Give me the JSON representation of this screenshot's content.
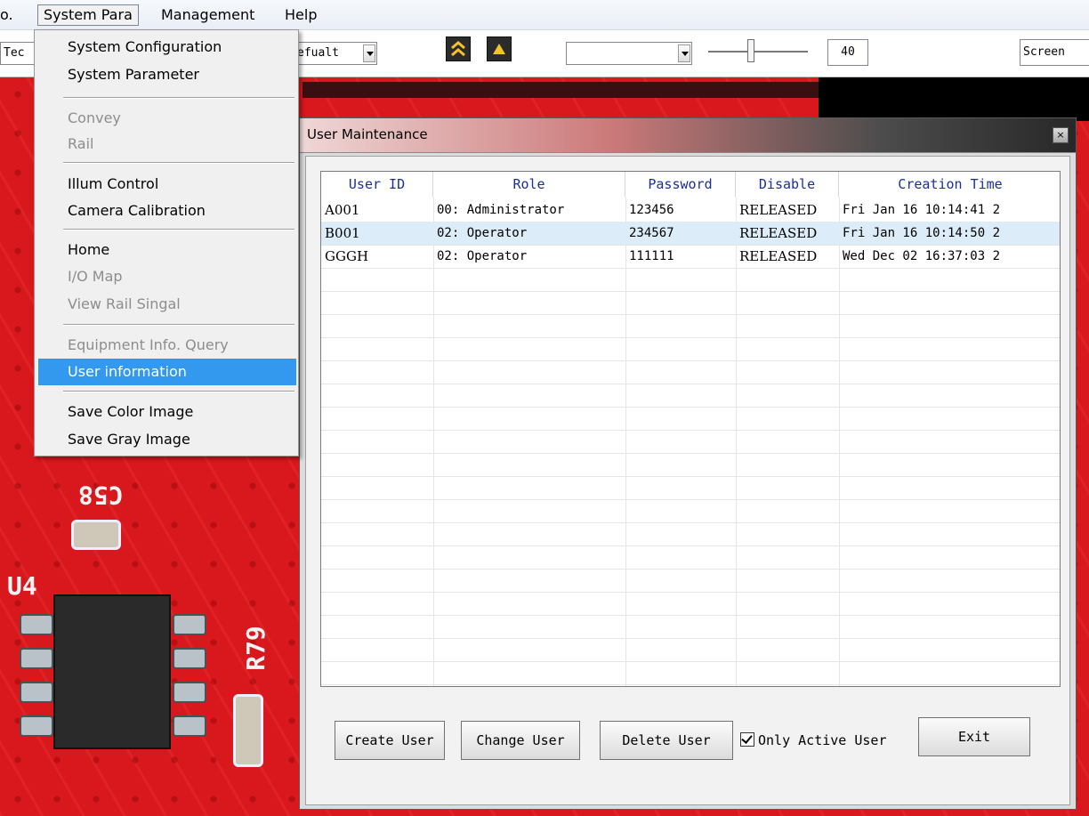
{
  "menubar": {
    "items": [
      "o.",
      "System Para",
      "Management",
      "Help"
    ]
  },
  "toolbar": {
    "left_combo": "Tec",
    "mode_combo": "efualt",
    "value_combo": "",
    "slider_value": 0.45,
    "number_box": "40",
    "screen_label": "Screen"
  },
  "menu": {
    "items": [
      {
        "label": "System Configuration",
        "enabled": true
      },
      {
        "label": "System Parameter",
        "enabled": true
      },
      {
        "label": "Convey",
        "enabled": false
      },
      {
        "label": "Rail",
        "enabled": false
      },
      {
        "label": "Illum Control",
        "enabled": true
      },
      {
        "label": "Camera Calibration",
        "enabled": true
      },
      {
        "label": "Home",
        "enabled": true
      },
      {
        "label": "I/O Map",
        "enabled": false
      },
      {
        "label": "View Rail Singal",
        "enabled": false
      },
      {
        "label": "Equipment Info. Query",
        "enabled": false
      },
      {
        "label": "User information",
        "enabled": true,
        "highlighted": true
      },
      {
        "label": "Save Color Image",
        "enabled": true
      },
      {
        "label": "Save Gray Image",
        "enabled": true
      }
    ]
  },
  "dialog": {
    "title": "User Maintenance",
    "close_label": "×",
    "columns": [
      "User ID",
      "Role",
      "Password",
      "Disable",
      "Creation Time"
    ],
    "rows": [
      {
        "user_id": "A001",
        "role": "00: Administrator",
        "password": "123456",
        "disable": "RELEASED",
        "creation_time": "Fri Jan 16 10:14:41 2",
        "selected": false
      },
      {
        "user_id": "B001",
        "role": "02: Operator",
        "password": "234567",
        "disable": "RELEASED",
        "creation_time": "Fri Jan 16 10:14:50 2",
        "selected": true
      },
      {
        "user_id": "GGGH",
        "role": "02: Operator",
        "password": "111111",
        "disable": "RELEASED",
        "creation_time": "Wed Dec 02 16:37:03 2",
        "selected": false
      }
    ],
    "buttons": {
      "create": "Create User",
      "change": "Change User",
      "delete": "Delete User",
      "exit": "Exit"
    },
    "only_active": {
      "label": "Only Active User",
      "checked": true
    }
  },
  "background": {
    "silk_labels": [
      "C58",
      "U4",
      "R79"
    ]
  },
  "colors": {
    "menu_highlight": "#3399ee",
    "header_text": "#1a2f9c",
    "selected_row": "#dcedf9",
    "pcb_red": "#d8181c"
  }
}
